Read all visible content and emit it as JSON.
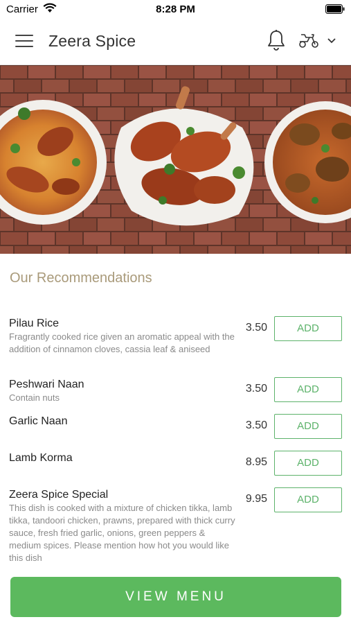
{
  "status_bar": {
    "carrier": "Carrier",
    "time": "8:28 PM"
  },
  "header": {
    "title": "Zeera Spice"
  },
  "section": {
    "title": "Our Recommendations"
  },
  "items": [
    {
      "name": "Pilau Rice",
      "description": "Fragrantly cooked rice given an aromatic appeal with the addition of cinnamon cloves, cassia leaf & aniseed",
      "price": "3.50",
      "button": "ADD"
    },
    {
      "name": "Peshwari Naan",
      "description": "Contain nuts",
      "price": "3.50",
      "button": "ADD"
    },
    {
      "name": "Garlic Naan",
      "description": "",
      "price": "3.50",
      "button": "ADD"
    },
    {
      "name": "Lamb Korma",
      "description": "",
      "price": "8.95",
      "button": "ADD"
    },
    {
      "name": "Zeera Spice Special",
      "description": "This dish is cooked with a mixture of chicken tikka, lamb tikka, tandoori chicken, prawns, prepared with thick curry sauce, fresh fried garlic, onions, green peppers & medium spices. Please mention how hot you would like this dish",
      "price": "9.95",
      "button": "ADD"
    }
  ],
  "footer": {
    "button": "VIEW MENU"
  },
  "colors": {
    "accent_green": "#5cb95e",
    "section_title": "#a99a7a",
    "brick": "#8e4a3a"
  },
  "icons": [
    "wifi-icon",
    "battery-icon",
    "hamburger-menu-icon",
    "bell-icon",
    "scooter-icon",
    "chevron-down-icon"
  ]
}
